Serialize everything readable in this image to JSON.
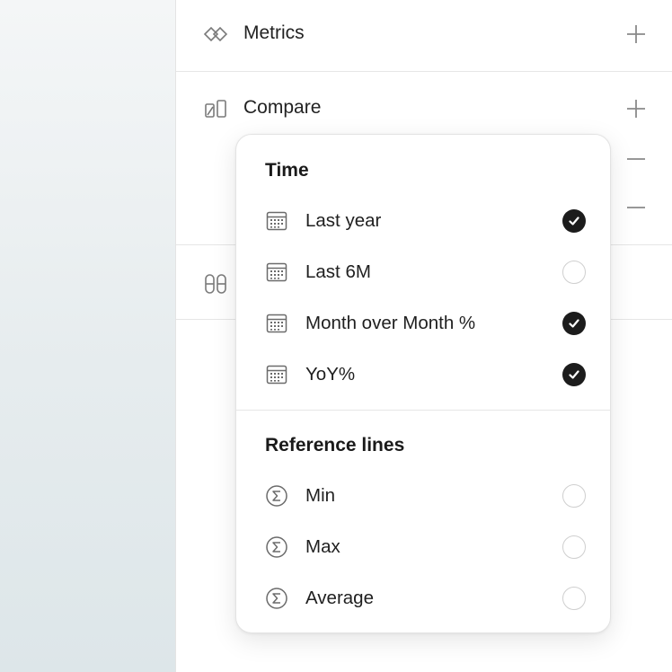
{
  "sidebar_sections": {
    "metrics": {
      "label": "Metrics",
      "icon": "diamond-link-icon",
      "action": "plus-icon"
    },
    "compare": {
      "label": "Compare",
      "icon": "compare-icon",
      "action": "plus-icon"
    },
    "third": {
      "label": "",
      "icon": "pill-pair-icon"
    }
  },
  "popover": {
    "time_title": "Time",
    "time_items": [
      {
        "label": "Last year",
        "checked": true,
        "icon": "calendar-icon"
      },
      {
        "label": "Last 6M",
        "checked": false,
        "icon": "calendar-icon"
      },
      {
        "label": "Month over Month %",
        "checked": true,
        "icon": "calendar-icon"
      },
      {
        "label": "YoY%",
        "checked": true,
        "icon": "calendar-icon"
      }
    ],
    "reference_title": "Reference lines",
    "reference_items": [
      {
        "label": "Min",
        "checked": false,
        "icon": "sigma-icon"
      },
      {
        "label": "Max",
        "checked": false,
        "icon": "sigma-icon"
      },
      {
        "label": "Average",
        "checked": false,
        "icon": "sigma-icon"
      }
    ]
  },
  "colors": {
    "check_on": "#1c1c1c",
    "check_off_border": "#cfcfcf",
    "divider": "#e6e6e6"
  }
}
